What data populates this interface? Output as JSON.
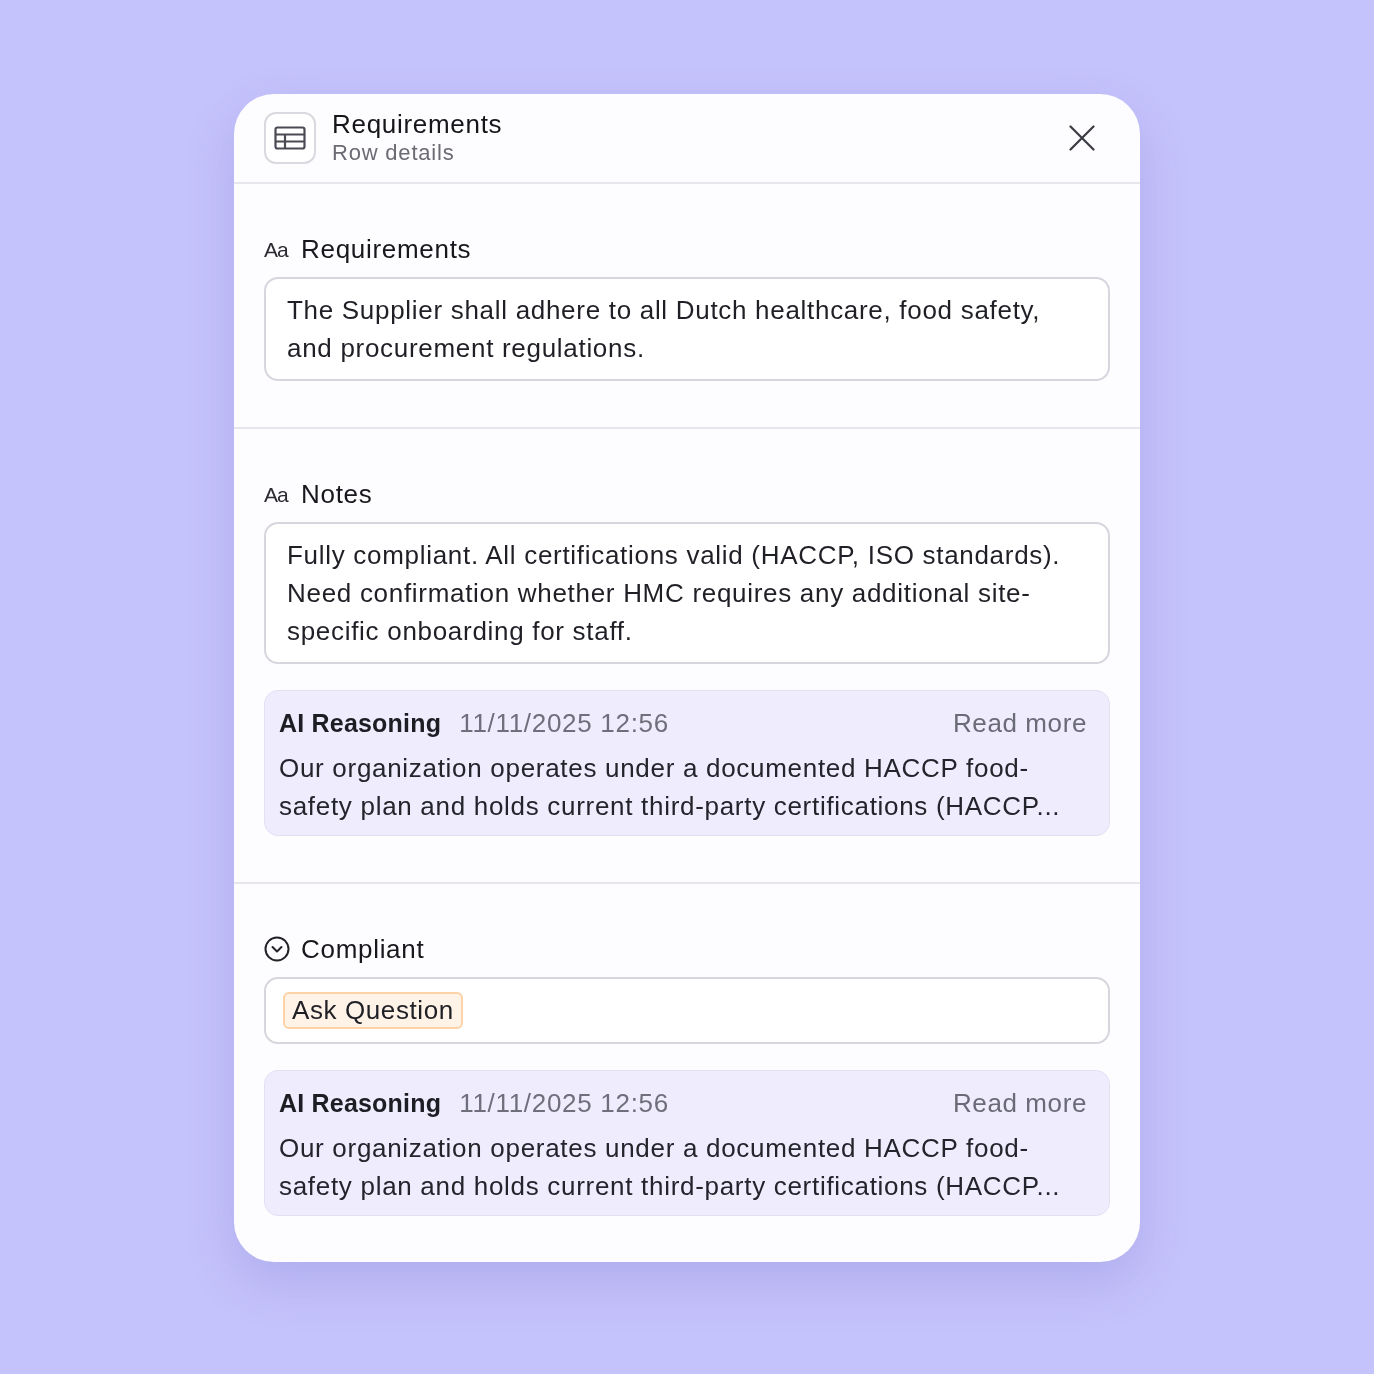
{
  "header": {
    "title": "Requirements",
    "subtitle": "Row details"
  },
  "fields": [
    {
      "kind": "text",
      "type_icon": "Aa",
      "label": "Requirements",
      "value": "The Supplier shall adhere to all Dutch healthcare, food safety, and procurement regulations."
    },
    {
      "kind": "text",
      "type_icon": "Aa",
      "label": "Notes",
      "value": "Fully compliant. All certifications valid (HACCP, ISO standards). Need confirmation whether HMC requires any additional site-specific onboarding for staff.",
      "reasoning": {
        "title": "AI Reasoning",
        "timestamp": "11/11/2025 12:56",
        "link": "Read more",
        "text": "Our organization operates under a documented HACCP food-safety plan and holds current third-party certifications (HACCP..."
      }
    },
    {
      "kind": "select",
      "label": "Compliant",
      "tags": [
        {
          "label": "Ask Question"
        }
      ],
      "reasoning": {
        "title": "AI Reasoning",
        "timestamp": "11/11/2025 12:56",
        "link": "Read more",
        "text": "Our organization operates under a documented HACCP food-safety plan and holds current third-party certifications (HACCP..."
      }
    }
  ]
}
